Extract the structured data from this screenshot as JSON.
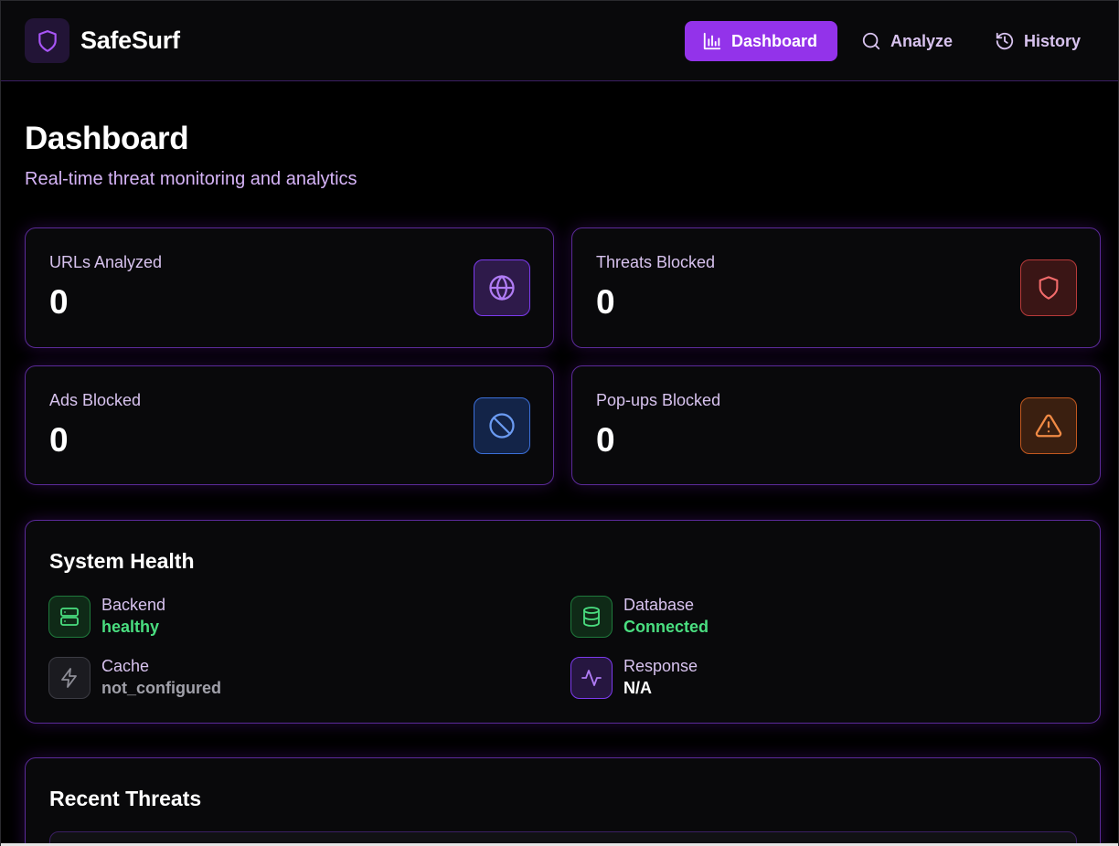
{
  "header": {
    "brand": "SafeSurf",
    "nav": [
      {
        "label": "Dashboard",
        "icon": "bar-chart-icon",
        "active": true
      },
      {
        "label": "Analyze",
        "icon": "search-icon",
        "active": false
      },
      {
        "label": "History",
        "icon": "history-icon",
        "active": false
      }
    ]
  },
  "page": {
    "title": "Dashboard",
    "subtitle": "Real-time threat monitoring and analytics"
  },
  "stats": [
    {
      "label": "URLs Analyzed",
      "value": "0",
      "icon": "globe-icon",
      "color": "#a855f7"
    },
    {
      "label": "Threats Blocked",
      "value": "0",
      "icon": "shield-icon",
      "color": "#ef4444"
    },
    {
      "label": "Ads Blocked",
      "value": "0",
      "icon": "ban-icon",
      "color": "#3b82f6"
    },
    {
      "label": "Pop-ups Blocked",
      "value": "0",
      "icon": "alert-triangle-icon",
      "color": "#f97316"
    }
  ],
  "health": {
    "title": "System Health",
    "items": [
      {
        "name": "Backend",
        "status": "healthy",
        "icon": "server-icon"
      },
      {
        "name": "Database",
        "status": "Connected",
        "icon": "database-icon"
      },
      {
        "name": "Cache",
        "status": "not_configured",
        "icon": "zap-icon"
      },
      {
        "name": "Response",
        "status": "N/A",
        "icon": "activity-icon"
      }
    ]
  },
  "recent": {
    "title": "Recent Threats"
  },
  "colors": {
    "accent": "#9333ea",
    "card_border": "#5b2a99",
    "success": "#4ade80",
    "background": "#000000"
  }
}
